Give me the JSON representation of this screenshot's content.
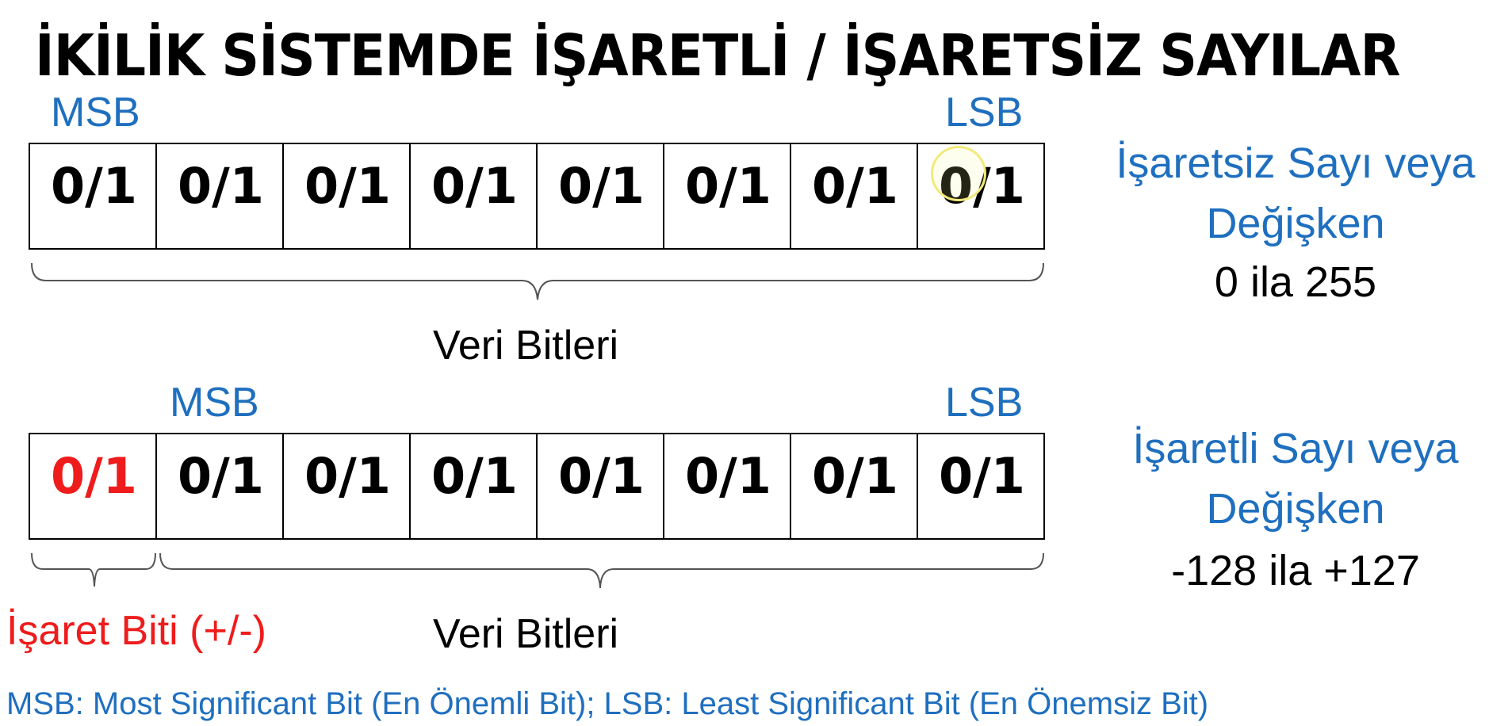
{
  "title": "İKİLİK SİSTEMDE İŞARETLİ / İŞARETSİZ SAYILAR",
  "unsigned": {
    "msb": "MSB",
    "lsb": "LSB",
    "bits": [
      "0/1",
      "0/1",
      "0/1",
      "0/1",
      "0/1",
      "0/1",
      "0/1",
      "0/1"
    ],
    "data_bits_label": "Veri Bitleri",
    "desc_line1": "İşaretsiz Sayı veya",
    "desc_line2": "Değişken",
    "range": "0 ila 255"
  },
  "signed": {
    "msb": "MSB",
    "lsb": "LSB",
    "bits": [
      "0/1",
      "0/1",
      "0/1",
      "0/1",
      "0/1",
      "0/1",
      "0/1",
      "0/1"
    ],
    "sign_bit_label": "İşaret Biti (+/-)",
    "data_bits_label": "Veri Bitleri",
    "desc_line1": "İşaretli Sayı veya",
    "desc_line2": "Değişken",
    "range": "-128 ila +127"
  },
  "footnote": "MSB: Most Significant Bit (En Önemli Bit); LSB: Least Significant Bit (En Önemsiz Bit)",
  "colors": {
    "blue": "#1f6fbf",
    "red": "#ee1c1c",
    "black": "#000000"
  }
}
